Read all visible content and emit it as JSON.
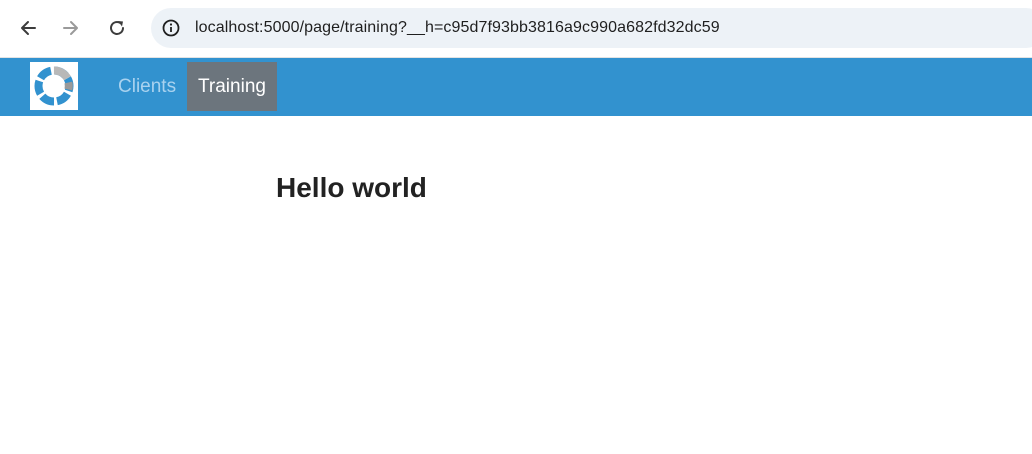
{
  "browser": {
    "url": "localhost:5000/page/training?__h=c95d7f93bb3816a9c990a682fd32dc59",
    "back_icon": "arrow-left-icon",
    "forward_icon": "arrow-right-icon",
    "reload_icon": "reload-icon",
    "site_info_icon": "info-icon"
  },
  "navbar": {
    "background": "#3292cf",
    "logo_icon": "ring-logo-icon",
    "links": [
      {
        "label": "Clients",
        "active": false
      },
      {
        "label": "Training",
        "active": true
      }
    ],
    "active_background": "#6c757d"
  },
  "main": {
    "heading": "Hello world"
  }
}
